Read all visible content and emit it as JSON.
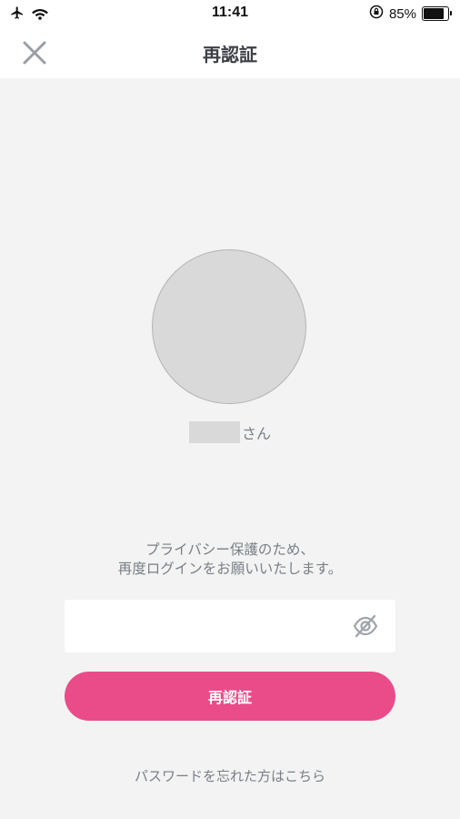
{
  "status_bar": {
    "time": "11:41",
    "battery_text": "85%",
    "battery_level": 0.85,
    "icons": [
      "airplane-icon",
      "wifi-icon",
      "orientation-lock-icon",
      "battery-icon"
    ]
  },
  "header": {
    "title": "再認証",
    "close_icon": "close-icon"
  },
  "profile": {
    "name_suffix": "さん"
  },
  "message": {
    "line1": "プライバシー保護のため、",
    "line2": "再度ログインをお願いいたします。"
  },
  "password": {
    "value": "",
    "placeholder": "",
    "visibility_icon": "eye-slash-icon"
  },
  "actions": {
    "submit_label": "再認証",
    "forgot_label": "パスワードを忘れた方はこちら"
  },
  "colors": {
    "accent": "#ea4c89",
    "background": "#f2f3f2",
    "muted_text": "#7a7f87",
    "title_text": "#3c3f45"
  }
}
